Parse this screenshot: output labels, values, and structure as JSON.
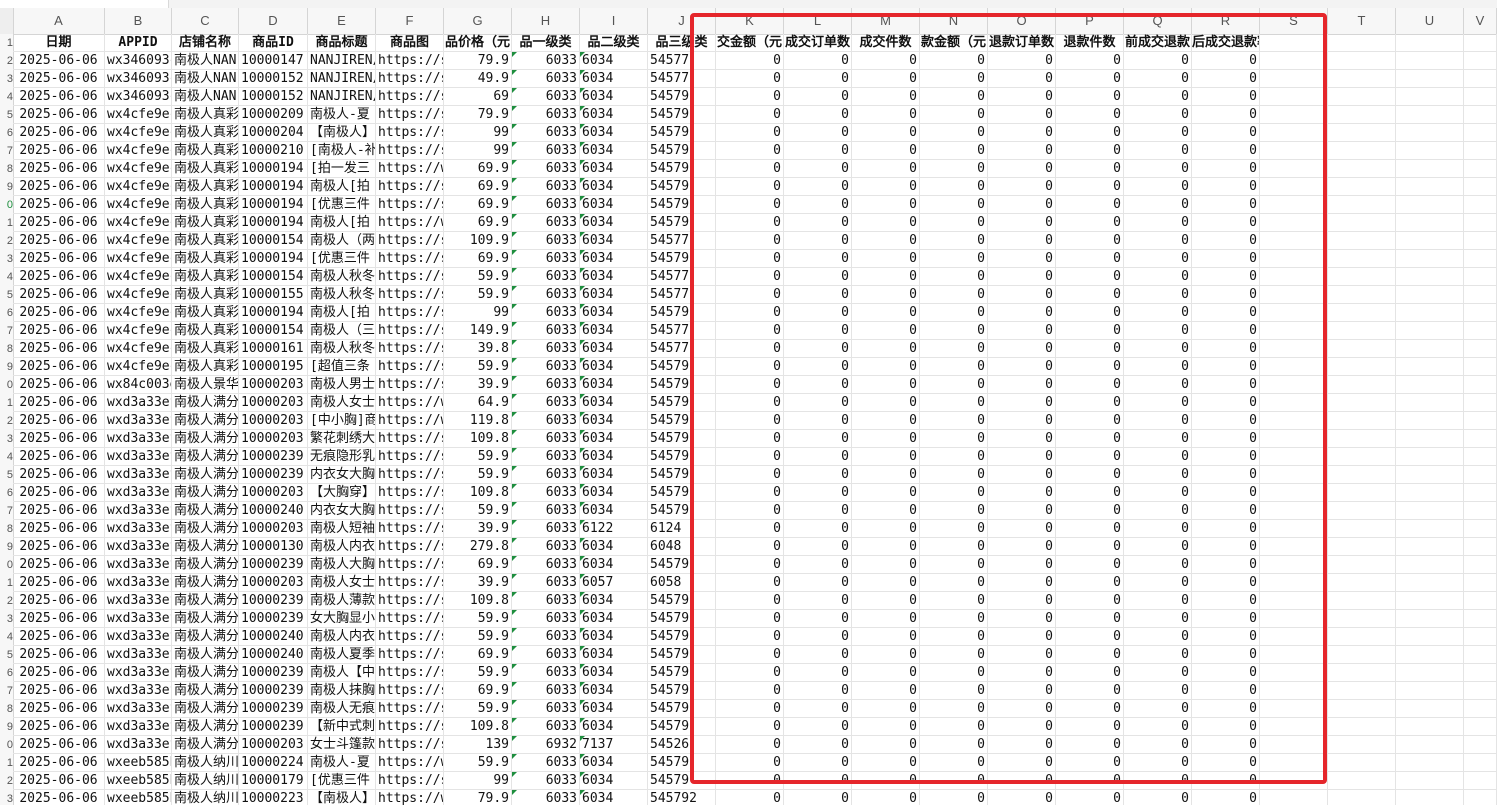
{
  "columns": [
    "A",
    "B",
    "C",
    "D",
    "E",
    "F",
    "G",
    "H",
    "I",
    "J",
    "K",
    "L",
    "M",
    "N",
    "O",
    "P",
    "Q",
    "R",
    "S",
    "T",
    "U",
    "V"
  ],
  "row_labels": [
    "1",
    "2",
    "3",
    "4",
    "5",
    "6",
    "7",
    "8",
    "9",
    "0",
    "1",
    "2",
    "3",
    "4",
    "5",
    "6",
    "7",
    "8",
    "9",
    "0",
    "1",
    "2",
    "3",
    "4",
    "5",
    "6",
    "7",
    "8",
    "9",
    "0",
    "1",
    "2",
    "3",
    "4",
    "5",
    "6",
    "7",
    "8",
    "9",
    "0",
    "1",
    "2",
    "3"
  ],
  "headers": [
    "日期",
    "APPID",
    "店铺名称",
    "商品ID",
    "商品标题",
    "商品图",
    "品价格（元",
    "品一级类",
    "品二级类",
    "品三级类",
    "交金额（元",
    "成交订单数",
    "成交件数",
    "款金额（元",
    "退款订单数",
    "退款件数",
    "前成交退款",
    "后成交退款率"
  ],
  "rows": [
    [
      "2025-06-06",
      "wx346093c",
      "南极人NAN",
      "10000147",
      "NANJIREN/",
      "https://s",
      "79.9",
      "6033",
      "6034",
      "54577",
      "0",
      "0",
      "0",
      "0",
      "0",
      "0",
      "0",
      "0"
    ],
    [
      "2025-06-06",
      "wx346093c",
      "南极人NAN",
      "10000152",
      "NANJIREN/",
      "https://s",
      "49.9",
      "6033",
      "6034",
      "54577",
      "0",
      "0",
      "0",
      "0",
      "0",
      "0",
      "0",
      "0"
    ],
    [
      "2025-06-06",
      "wx346093c",
      "南极人NAN",
      "10000152",
      "NANJIREN/",
      "https://s",
      "69",
      "6033",
      "6034",
      "54579",
      "0",
      "0",
      "0",
      "0",
      "0",
      "0",
      "0",
      "0"
    ],
    [
      "2025-06-06",
      "wx4cfe9ec",
      "南极人真彩",
      "10000209",
      "南极人-夏",
      "https://s",
      "79.9",
      "6033",
      "6034",
      "54579",
      "0",
      "0",
      "0",
      "0",
      "0",
      "0",
      "0",
      "0"
    ],
    [
      "2025-06-06",
      "wx4cfe9ec",
      "南极人真彩",
      "10000204",
      "【南极人】",
      "https://s",
      "99",
      "6033",
      "6034",
      "54579",
      "0",
      "0",
      "0",
      "0",
      "0",
      "0",
      "0",
      "0"
    ],
    [
      "2025-06-06",
      "wx4cfe9ec",
      "南极人真彩",
      "10000210",
      "[南极人-补",
      "https://s",
      "99",
      "6033",
      "6034",
      "54579",
      "0",
      "0",
      "0",
      "0",
      "0",
      "0",
      "0",
      "0"
    ],
    [
      "2025-06-06",
      "wx4cfe9ec",
      "南极人真彩",
      "10000194",
      "[拍一发三",
      "https://w",
      "69.9",
      "6033",
      "6034",
      "54579",
      "0",
      "0",
      "0",
      "0",
      "0",
      "0",
      "0",
      "0"
    ],
    [
      "2025-06-06",
      "wx4cfe9ec",
      "南极人真彩",
      "10000194",
      "南极人[拍",
      "https://s",
      "69.9",
      "6033",
      "6034",
      "54579",
      "0",
      "0",
      "0",
      "0",
      "0",
      "0",
      "0",
      "0"
    ],
    [
      "2025-06-06",
      "wx4cfe9ec",
      "南极人真彩",
      "10000194",
      "[优惠三件",
      "https://s",
      "69.9",
      "6033",
      "6034",
      "54579",
      "0",
      "0",
      "0",
      "0",
      "0",
      "0",
      "0",
      "0"
    ],
    [
      "2025-06-06",
      "wx4cfe9ec",
      "南极人真彩",
      "10000194",
      "南极人[拍",
      "https://w",
      "69.9",
      "6033",
      "6034",
      "54579",
      "0",
      "0",
      "0",
      "0",
      "0",
      "0",
      "0",
      "0"
    ],
    [
      "2025-06-06",
      "wx4cfe9ec",
      "南极人真彩",
      "10000154",
      "南极人（两",
      "https://s",
      "109.9",
      "6033",
      "6034",
      "54577",
      "0",
      "0",
      "0",
      "0",
      "0",
      "0",
      "0",
      "0"
    ],
    [
      "2025-06-06",
      "wx4cfe9ec",
      "南极人真彩",
      "10000194",
      "[优惠三件",
      "https://s",
      "69.9",
      "6033",
      "6034",
      "54579",
      "0",
      "0",
      "0",
      "0",
      "0",
      "0",
      "0",
      "0"
    ],
    [
      "2025-06-06",
      "wx4cfe9ec",
      "南极人真彩",
      "10000154",
      "南极人秋冬",
      "https://s",
      "59.9",
      "6033",
      "6034",
      "54577",
      "0",
      "0",
      "0",
      "0",
      "0",
      "0",
      "0",
      "0"
    ],
    [
      "2025-06-06",
      "wx4cfe9ec",
      "南极人真彩",
      "10000155",
      "南极人秋冬",
      "https://s",
      "59.9",
      "6033",
      "6034",
      "54577",
      "0",
      "0",
      "0",
      "0",
      "0",
      "0",
      "0",
      "0"
    ],
    [
      "2025-06-06",
      "wx4cfe9ec",
      "南极人真彩",
      "10000194",
      "南极人[拍",
      "https://s",
      "99",
      "6033",
      "6034",
      "54579",
      "0",
      "0",
      "0",
      "0",
      "0",
      "0",
      "0",
      "0"
    ],
    [
      "2025-06-06",
      "wx4cfe9ec",
      "南极人真彩",
      "10000154",
      "南极人（三",
      "https://s",
      "149.9",
      "6033",
      "6034",
      "54577",
      "0",
      "0",
      "0",
      "0",
      "0",
      "0",
      "0",
      "0"
    ],
    [
      "2025-06-06",
      "wx4cfe9ec",
      "南极人真彩",
      "10000161",
      "南极人秋冬",
      "https://s",
      "39.8",
      "6033",
      "6034",
      "54577",
      "0",
      "0",
      "0",
      "0",
      "0",
      "0",
      "0",
      "0"
    ],
    [
      "2025-06-06",
      "wx4cfe9ec",
      "南极人真彩",
      "10000195",
      "[超值三条",
      "https://s",
      "59.9",
      "6033",
      "6034",
      "54579",
      "0",
      "0",
      "0",
      "0",
      "0",
      "0",
      "0",
      "0"
    ],
    [
      "2025-06-06",
      "wx84c003e",
      "南极人景华",
      "10000203",
      "南极人男士",
      "https://s",
      "39.9",
      "6033",
      "6034",
      "54579",
      "0",
      "0",
      "0",
      "0",
      "0",
      "0",
      "0",
      "0"
    ],
    [
      "2025-06-06",
      "wxd3a33ef",
      "南极人满分",
      "10000203",
      "南极人女士",
      "https://w",
      "64.9",
      "6033",
      "6034",
      "54579",
      "0",
      "0",
      "0",
      "0",
      "0",
      "0",
      "0",
      "0"
    ],
    [
      "2025-06-06",
      "wxd3a33ef",
      "南极人满分",
      "10000203",
      "[中小胸]商",
      "https://w",
      "119.8",
      "6033",
      "6034",
      "54579",
      "0",
      "0",
      "0",
      "0",
      "0",
      "0",
      "0",
      "0"
    ],
    [
      "2025-06-06",
      "wxd3a33ef",
      "南极人满分",
      "10000203",
      "繁花刺绣大",
      "https://s",
      "109.8",
      "6033",
      "6034",
      "54579",
      "0",
      "0",
      "0",
      "0",
      "0",
      "0",
      "0",
      "0"
    ],
    [
      "2025-06-06",
      "wxd3a33ef",
      "南极人满分",
      "10000239",
      "无痕隐形乳",
      "https://s",
      "59.9",
      "6033",
      "6034",
      "54579",
      "0",
      "0",
      "0",
      "0",
      "0",
      "0",
      "0",
      "0"
    ],
    [
      "2025-06-06",
      "wxd3a33ef",
      "南极人满分",
      "10000239",
      "内衣女大胸",
      "https://s",
      "59.9",
      "6033",
      "6034",
      "54579",
      "0",
      "0",
      "0",
      "0",
      "0",
      "0",
      "0",
      "0"
    ],
    [
      "2025-06-06",
      "wxd3a33ef",
      "南极人满分",
      "10000203",
      "【大胸穿】",
      "https://s",
      "109.8",
      "6033",
      "6034",
      "54579",
      "0",
      "0",
      "0",
      "0",
      "0",
      "0",
      "0",
      "0"
    ],
    [
      "2025-06-06",
      "wxd3a33ef",
      "南极人满分",
      "10000240",
      "内衣女大胸",
      "https://s",
      "59.9",
      "6033",
      "6034",
      "54579",
      "0",
      "0",
      "0",
      "0",
      "0",
      "0",
      "0",
      "0"
    ],
    [
      "2025-06-06",
      "wxd3a33ef",
      "南极人满分",
      "10000203",
      "南极人短袖",
      "https://s",
      "39.9",
      "6033",
      "6122",
      "6124",
      "0",
      "0",
      "0",
      "0",
      "0",
      "0",
      "0",
      "0"
    ],
    [
      "2025-06-06",
      "wxd3a33ef",
      "南极人满分",
      "10000130",
      "南极人内衣",
      "https://s",
      "279.8",
      "6033",
      "6034",
      "6048",
      "0",
      "0",
      "0",
      "0",
      "0",
      "0",
      "0",
      "0"
    ],
    [
      "2025-06-06",
      "wxd3a33ef",
      "南极人满分",
      "10000239",
      "南极人大胸",
      "https://s",
      "69.9",
      "6033",
      "6034",
      "54579",
      "0",
      "0",
      "0",
      "0",
      "0",
      "0",
      "0",
      "0"
    ],
    [
      "2025-06-06",
      "wxd3a33ef",
      "南极人满分",
      "10000203",
      "南极人女士",
      "https://s",
      "39.9",
      "6033",
      "6057",
      "6058",
      "0",
      "0",
      "0",
      "0",
      "0",
      "0",
      "0",
      "0"
    ],
    [
      "2025-06-06",
      "wxd3a33ef",
      "南极人满分",
      "10000239",
      "南极人薄款",
      "https://s",
      "109.8",
      "6033",
      "6034",
      "54579",
      "0",
      "0",
      "0",
      "0",
      "0",
      "0",
      "0",
      "0"
    ],
    [
      "2025-06-06",
      "wxd3a33ef",
      "南极人满分",
      "10000239",
      "女大胸显小",
      "https://s",
      "59.9",
      "6033",
      "6034",
      "54579",
      "0",
      "0",
      "0",
      "0",
      "0",
      "0",
      "0",
      "0"
    ],
    [
      "2025-06-06",
      "wxd3a33ef",
      "南极人满分",
      "10000240",
      "南极人内衣",
      "https://s",
      "59.9",
      "6033",
      "6034",
      "54579",
      "0",
      "0",
      "0",
      "0",
      "0",
      "0",
      "0",
      "0"
    ],
    [
      "2025-06-06",
      "wxd3a33ef",
      "南极人满分",
      "10000240",
      "南极人夏季",
      "https://s",
      "69.9",
      "6033",
      "6034",
      "54579",
      "0",
      "0",
      "0",
      "0",
      "0",
      "0",
      "0",
      "0"
    ],
    [
      "2025-06-06",
      "wxd3a33ef",
      "南极人满分",
      "10000239",
      "南极人【中",
      "https://s",
      "59.9",
      "6033",
      "6034",
      "54579",
      "0",
      "0",
      "0",
      "0",
      "0",
      "0",
      "0",
      "0"
    ],
    [
      "2025-06-06",
      "wxd3a33ef",
      "南极人满分",
      "10000239",
      "南极人抹胸",
      "https://s",
      "69.9",
      "6033",
      "6034",
      "54579",
      "0",
      "0",
      "0",
      "0",
      "0",
      "0",
      "0",
      "0"
    ],
    [
      "2025-06-06",
      "wxd3a33ef",
      "南极人满分",
      "10000239",
      "南极人无痕",
      "https://s",
      "59.9",
      "6033",
      "6034",
      "54579",
      "0",
      "0",
      "0",
      "0",
      "0",
      "0",
      "0",
      "0"
    ],
    [
      "2025-06-06",
      "wxd3a33ef",
      "南极人满分",
      "10000239",
      "【新中式刺",
      "https://s",
      "109.8",
      "6033",
      "6034",
      "54579",
      "0",
      "0",
      "0",
      "0",
      "0",
      "0",
      "0",
      "0"
    ],
    [
      "2025-06-06",
      "wxd3a33ef",
      "南极人满分",
      "10000203",
      "女士斗篷款",
      "https://s",
      "139",
      "6932",
      "7137",
      "54526",
      "0",
      "0",
      "0",
      "0",
      "0",
      "0",
      "0",
      "0"
    ],
    [
      "2025-06-06",
      "wxeeb585b",
      "南极人纳川",
      "10000224",
      "南极人-夏",
      "https://w",
      "59.9",
      "6033",
      "6034",
      "54579",
      "0",
      "0",
      "0",
      "0",
      "0",
      "0",
      "0",
      "0"
    ],
    [
      "2025-06-06",
      "wxeeb585b",
      "南极人纳川",
      "10000179",
      "[优惠三件",
      "https://s",
      "99",
      "6033",
      "6034",
      "54579",
      "0",
      "0",
      "0",
      "0",
      "0",
      "0",
      "0",
      "0"
    ],
    [
      "2025-06-06",
      "wxeeb585b",
      "南极人纳川",
      "10000223",
      "【南极人】",
      "https://w",
      "79.9",
      "6033",
      "6034",
      "545792",
      "0",
      "0",
      "0",
      "0",
      "0",
      "0",
      "0",
      "0"
    ]
  ]
}
